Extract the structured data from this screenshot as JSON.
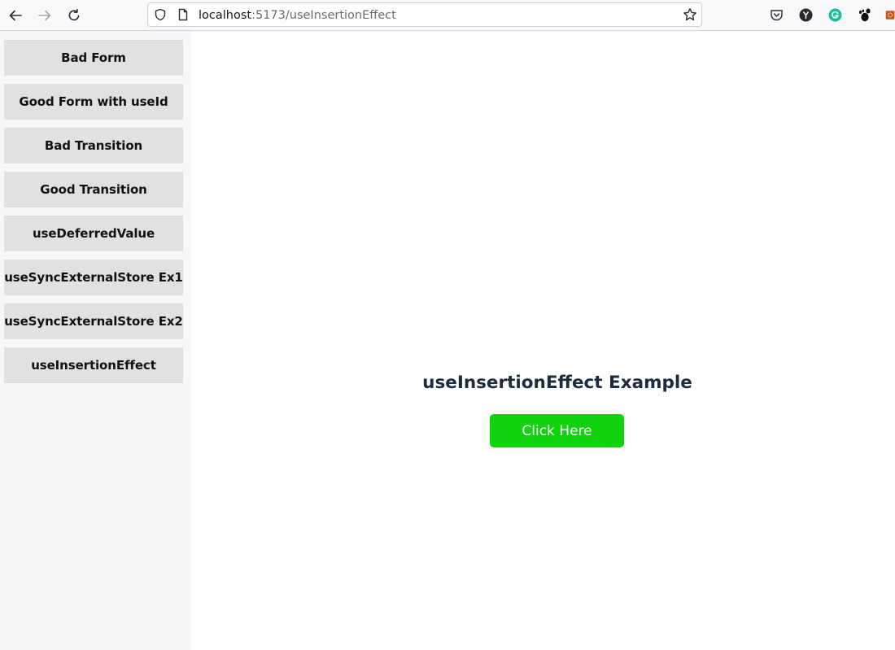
{
  "browser": {
    "url_host": "localhost",
    "url_rest": ":5173/useInsertionEffect",
    "icons": {
      "back": "back-arrow-icon",
      "forward": "forward-arrow-icon",
      "reload": "reload-icon",
      "shield": "tracking-protection-shield-icon",
      "page": "page-info-icon",
      "bookmark": "bookmark-star-icon",
      "pocket": "pocket-icon",
      "ext_y": "y-extension-icon",
      "grammarly": "grammarly-extension-icon",
      "gnome": "gnome-extension-icon",
      "ext_last": "extension-icon"
    },
    "colors": {
      "grammarly": "#15c39a",
      "ext_last": "#c8501e"
    }
  },
  "sidebar": {
    "items": [
      {
        "label": "Bad Form"
      },
      {
        "label": "Good Form with useId"
      },
      {
        "label": "Bad Transition"
      },
      {
        "label": "Good Transition"
      },
      {
        "label": "useDeferredValue"
      },
      {
        "label": "useSyncExternalStore Ex1"
      },
      {
        "label": "useSyncExternalStore Ex2"
      },
      {
        "label": "useInsertionEffect"
      }
    ]
  },
  "main": {
    "heading": "useInsertionEffect Example",
    "button_label": "Click Here",
    "button_color": "#12d10f"
  }
}
